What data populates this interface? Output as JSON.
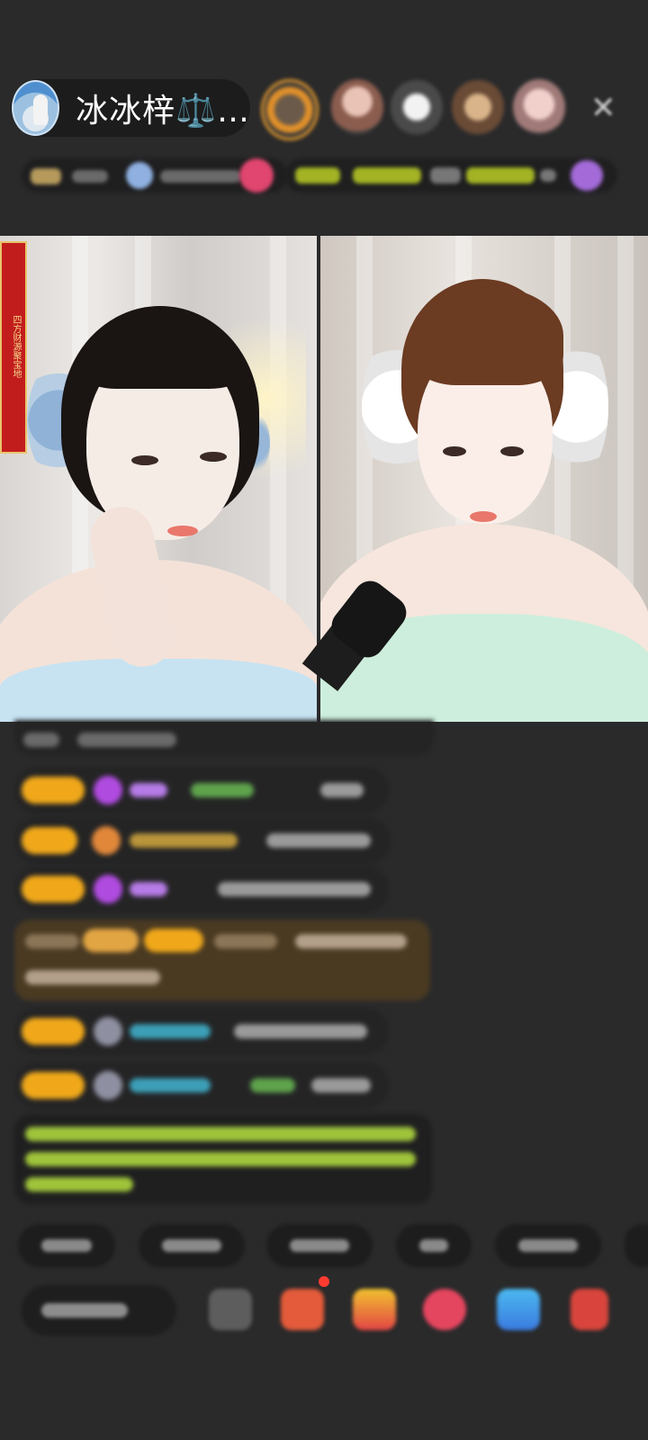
{
  "header": {
    "host_name": "冰冰梓⚖️…"
  },
  "banner": {
    "text": "四方财源聚宝地"
  }
}
